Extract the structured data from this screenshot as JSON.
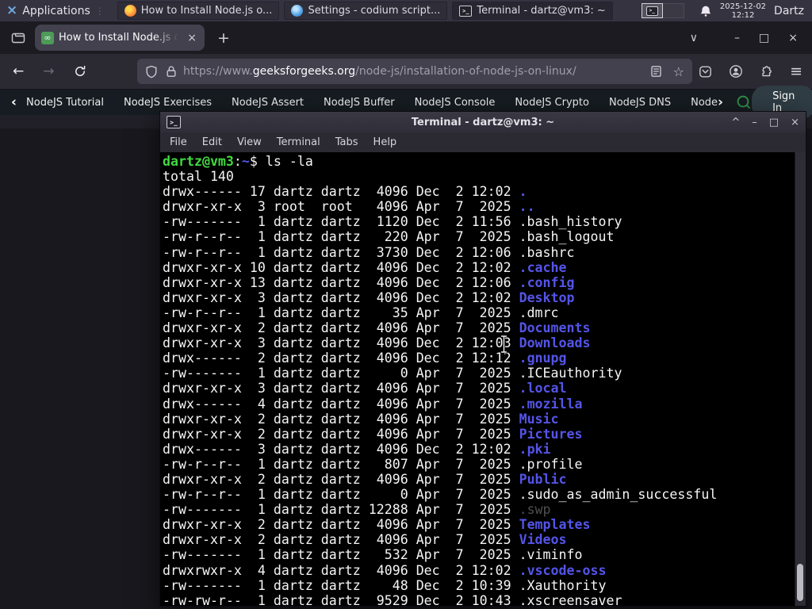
{
  "glyphs": {
    "app_logo": "×",
    "grip": "⋮",
    "terminal_glyph": ">_",
    "favicon_glyph": "∞",
    "close": "×",
    "plus": "+",
    "tab_list": "∨",
    "minimize": "–",
    "maximize": "□",
    "shade": "^",
    "back_chevron": "‹",
    "more_chevron": "›",
    "hamburger": "≡",
    "star": "☆",
    "back_arrow": "←",
    "forward_arrow": "→"
  },
  "panel": {
    "applications": "Applications",
    "tasks": [
      {
        "label": "How to Install Node.js o...",
        "icon": "firefox-icon"
      },
      {
        "label": "Settings - codium script...",
        "icon": "vscodium-icon"
      },
      {
        "label": "Terminal - dartz@vm3: ~",
        "icon": "terminal-icon"
      }
    ],
    "clock": {
      "date": "2025-12-02",
      "time": "12:12"
    },
    "user": "Dartz"
  },
  "browser": {
    "tab_title": "How to Install Node.js on",
    "url": {
      "prefix": "https://www.",
      "domain": "geeksforgeeks.org",
      "path": "/node-js/installation-of-node-js-on-linux/"
    }
  },
  "gfg": {
    "items": [
      "NodeJS Tutorial",
      "NodeJS Exercises",
      "NodeJS Assert",
      "NodeJS Buffer",
      "NodeJS Console",
      "NodeJS Crypto",
      "NodeJS DNS",
      "Node"
    ],
    "sign_in": "Sign In",
    "accent_green": "#2f8d46"
  },
  "terminal": {
    "title": "Terminal - dartz@vm3: ~",
    "menu": [
      "File",
      "Edit",
      "View",
      "Terminal",
      "Tabs",
      "Help"
    ],
    "colors": {
      "green": "#41d941",
      "blue": "#5454e8",
      "fg": "#f5f5f5",
      "dim": "#4f4f4f",
      "bg": "#000000"
    },
    "lines": [
      [
        {
          "t": "dartz@vm3",
          "c": "g"
        },
        {
          "t": ":",
          "c": "f"
        },
        {
          "t": "~",
          "c": "b"
        },
        {
          "t": "$ ls -la",
          "c": "f"
        }
      ],
      [
        {
          "t": "total 140",
          "c": "f"
        }
      ],
      [
        {
          "t": "drwx------ 17 dartz dartz  4096 Dec  2 12:02 ",
          "c": "f"
        },
        {
          "t": ".",
          "c": "b"
        }
      ],
      [
        {
          "t": "drwxr-xr-x  3 root  root   4096 Apr  7  2025 ",
          "c": "f"
        },
        {
          "t": "..",
          "c": "b"
        }
      ],
      [
        {
          "t": "-rw-------  1 dartz dartz  1120 Dec  2 11:56 .bash_history",
          "c": "f"
        }
      ],
      [
        {
          "t": "-rw-r--r--  1 dartz dartz   220 Apr  7  2025 .bash_logout",
          "c": "f"
        }
      ],
      [
        {
          "t": "-rw-r--r--  1 dartz dartz  3730 Dec  2 12:06 .bashrc",
          "c": "f"
        }
      ],
      [
        {
          "t": "drwxr-xr-x 10 dartz dartz  4096 Dec  2 12:02 ",
          "c": "f"
        },
        {
          "t": ".cache",
          "c": "b"
        }
      ],
      [
        {
          "t": "drwxr-xr-x 13 dartz dartz  4096 Dec  2 12:06 ",
          "c": "f"
        },
        {
          "t": ".config",
          "c": "b"
        }
      ],
      [
        {
          "t": "drwxr-xr-x  3 dartz dartz  4096 Dec  2 12:02 ",
          "c": "f"
        },
        {
          "t": "Desktop",
          "c": "b"
        }
      ],
      [
        {
          "t": "-rw-r--r--  1 dartz dartz    35 Apr  7  2025 .dmrc",
          "c": "f"
        }
      ],
      [
        {
          "t": "drwxr-xr-x  2 dartz dartz  4096 Apr  7  2025 ",
          "c": "f"
        },
        {
          "t": "Documents",
          "c": "b"
        }
      ],
      [
        {
          "t": "drwxr-xr-x  3 dartz dartz  4096 Dec  2 12:03 ",
          "c": "f"
        },
        {
          "t": "Downloads",
          "c": "b"
        }
      ],
      [
        {
          "t": "drwx------  2 dartz dartz  4096 Dec  2 12:12 ",
          "c": "f"
        },
        {
          "t": ".gnupg",
          "c": "b"
        }
      ],
      [
        {
          "t": "-rw-------  1 dartz dartz     0 Apr  7  2025 .ICEauthority",
          "c": "f"
        }
      ],
      [
        {
          "t": "drwxr-xr-x  3 dartz dartz  4096 Apr  7  2025 ",
          "c": "f"
        },
        {
          "t": ".local",
          "c": "b"
        }
      ],
      [
        {
          "t": "drwx------  4 dartz dartz  4096 Apr  7  2025 ",
          "c": "f"
        },
        {
          "t": ".mozilla",
          "c": "b"
        }
      ],
      [
        {
          "t": "drwxr-xr-x  2 dartz dartz  4096 Apr  7  2025 ",
          "c": "f"
        },
        {
          "t": "Music",
          "c": "b"
        }
      ],
      [
        {
          "t": "drwxr-xr-x  2 dartz dartz  4096 Apr  7  2025 ",
          "c": "f"
        },
        {
          "t": "Pictures",
          "c": "b"
        }
      ],
      [
        {
          "t": "drwx------  3 dartz dartz  4096 Dec  2 12:02 ",
          "c": "f"
        },
        {
          "t": ".pki",
          "c": "b"
        }
      ],
      [
        {
          "t": "-rw-r--r--  1 dartz dartz   807 Apr  7  2025 .profile",
          "c": "f"
        }
      ],
      [
        {
          "t": "drwxr-xr-x  2 dartz dartz  4096 Apr  7  2025 ",
          "c": "f"
        },
        {
          "t": "Public",
          "c": "b"
        }
      ],
      [
        {
          "t": "-rw-r--r--  1 dartz dartz     0 Apr  7  2025 .sudo_as_admin_successful",
          "c": "f"
        }
      ],
      [
        {
          "t": "-rw-------  1 dartz dartz 12288 Apr  7  2025 ",
          "c": "f"
        },
        {
          "t": ".swp",
          "c": "d"
        }
      ],
      [
        {
          "t": "drwxr-xr-x  2 dartz dartz  4096 Apr  7  2025 ",
          "c": "f"
        },
        {
          "t": "Templates",
          "c": "b"
        }
      ],
      [
        {
          "t": "drwxr-xr-x  2 dartz dartz  4096 Apr  7  2025 ",
          "c": "f"
        },
        {
          "t": "Videos",
          "c": "b"
        }
      ],
      [
        {
          "t": "-rw-------  1 dartz dartz   532 Apr  7  2025 .viminfo",
          "c": "f"
        }
      ],
      [
        {
          "t": "drwxrwxr-x  4 dartz dartz  4096 Dec  2 12:02 ",
          "c": "f"
        },
        {
          "t": ".vscode-oss",
          "c": "b"
        }
      ],
      [
        {
          "t": "-rw-------  1 dartz dartz    48 Dec  2 10:39 .Xauthority",
          "c": "f"
        }
      ],
      [
        {
          "t": "-rw-rw-r--  1 dartz dartz  9529 Dec  2 10:43 .xscreensaver",
          "c": "f"
        }
      ]
    ]
  }
}
